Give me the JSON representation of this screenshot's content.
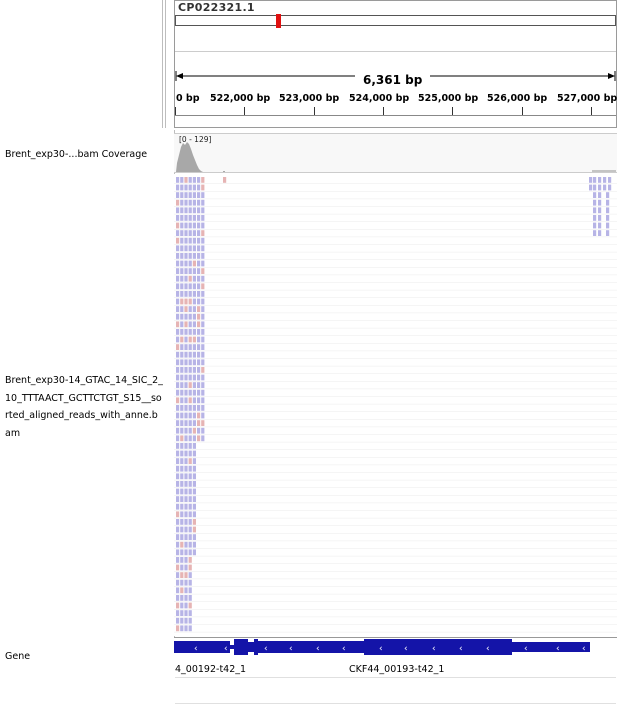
{
  "ruler": {
    "chromosome": "CP022321.1",
    "span": "6,361 bp",
    "ticks": [
      "0 bp",
      "522,000 bp",
      "523,000 bp",
      "524,000 bp",
      "525,000 bp",
      "526,000 bp",
      "527,000 bp"
    ]
  },
  "tracks": {
    "coverage_name": "Brent_exp30-...bam Coverage",
    "coverage_range": "[0 - 129]",
    "alignment_name": "Brent_exp30-14_GTAC_14_SIC_2_10_TTTAACT_GCTTCTGT_S15__sorted_aligned_reads_with_anne.bam",
    "gene_name": "Gene"
  },
  "genes": [
    {
      "label": "4_00192-t42_1"
    },
    {
      "label": "CKF44_00193-t42_1"
    }
  ],
  "colors": {
    "read": "#b7b4e6",
    "read_alt": "#e6b4b4",
    "gene": "#1414a8",
    "marker": "#e01010"
  }
}
